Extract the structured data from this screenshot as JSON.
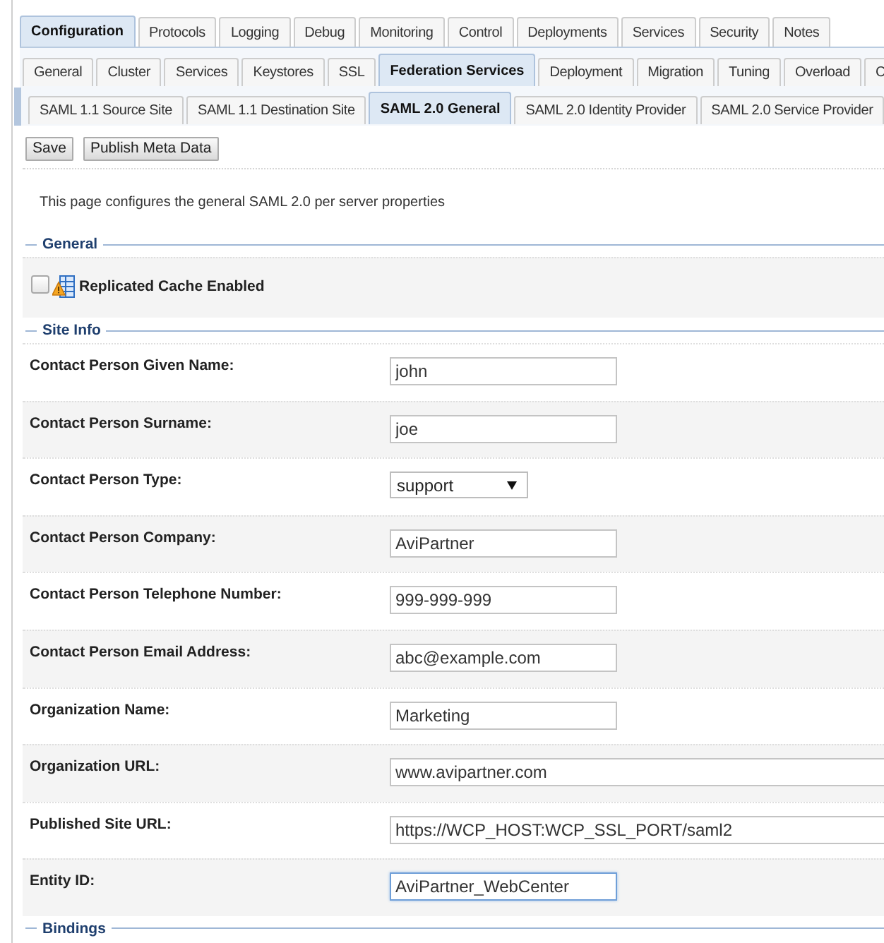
{
  "tab_rows": [
    {
      "tabs": [
        {
          "label": "Configuration",
          "selected": true
        },
        {
          "label": "Protocols",
          "selected": false
        },
        {
          "label": "Logging",
          "selected": false
        },
        {
          "label": "Debug",
          "selected": false
        },
        {
          "label": "Monitoring",
          "selected": false
        },
        {
          "label": "Control",
          "selected": false
        },
        {
          "label": "Deployments",
          "selected": false
        },
        {
          "label": "Services",
          "selected": false
        },
        {
          "label": "Security",
          "selected": false
        },
        {
          "label": "Notes",
          "selected": false
        }
      ]
    },
    {
      "tabs": [
        {
          "label": "General",
          "selected": false
        },
        {
          "label": "Cluster",
          "selected": false
        },
        {
          "label": "Services",
          "selected": false
        },
        {
          "label": "Keystores",
          "selected": false
        },
        {
          "label": "SSL",
          "selected": false
        },
        {
          "label": "Federation Services",
          "selected": true
        },
        {
          "label": "Deployment",
          "selected": false
        },
        {
          "label": "Migration",
          "selected": false
        },
        {
          "label": "Tuning",
          "selected": false
        },
        {
          "label": "Overload",
          "selected": false
        },
        {
          "label": "C",
          "selected": false
        }
      ]
    },
    {
      "tabs": [
        {
          "label": "SAML 1.1 Source Site",
          "selected": false
        },
        {
          "label": "SAML 1.1 Destination Site",
          "selected": false
        },
        {
          "label": "SAML 2.0 General",
          "selected": true
        },
        {
          "label": "SAML 2.0 Identity Provider",
          "selected": false
        },
        {
          "label": "SAML 2.0 Service Provider",
          "selected": false
        }
      ]
    }
  ],
  "buttons": [
    "Save",
    "Publish Meta Data"
  ],
  "description": "This page configures the general SAML 2.0 per server properties",
  "sections": [
    {
      "title": "General",
      "rows": [
        {
          "kind": "checkbox",
          "label": "Replicated Cache Enabled",
          "checked": false
        }
      ]
    },
    {
      "title": "Site Info",
      "rows": [
        {
          "kind": "text",
          "label": "Contact Person Given Name:",
          "value": "john",
          "focused": false
        },
        {
          "kind": "text",
          "label": "Contact Person Surname:",
          "value": "joe",
          "focused": false
        },
        {
          "kind": "select",
          "label": "Contact Person Type:",
          "value": "support"
        },
        {
          "kind": "text",
          "label": "Contact Person Company:",
          "value": "AviPartner",
          "focused": false
        },
        {
          "kind": "text",
          "label": "Contact Person Telephone Number:",
          "value": "999-999-999",
          "focused": false
        },
        {
          "kind": "text",
          "label": "Contact Person Email Address:",
          "value": "abc@example.com",
          "focused": false
        },
        {
          "kind": "text",
          "label": "Organization Name:",
          "value": "Marketing",
          "focused": false
        },
        {
          "kind": "url",
          "label": "Organization URL:",
          "value": "www.avipartner.com",
          "focused": false
        },
        {
          "kind": "url",
          "label": "Published Site URL:",
          "value": "https://WCP_HOST:WCP_SSL_PORT/saml2",
          "focused": false
        },
        {
          "kind": "text",
          "label": "Entity ID:",
          "value": "AviPartner_WebCenter",
          "focused": true
        }
      ]
    },
    {
      "title": "Bindings"
    }
  ]
}
